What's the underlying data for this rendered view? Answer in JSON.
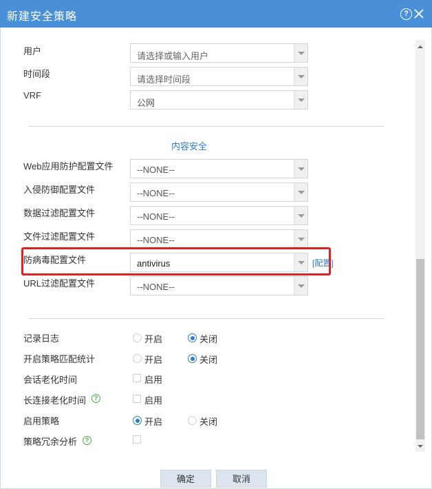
{
  "dialog": {
    "title": "新建安全策略",
    "help_symbol": "?"
  },
  "fields": {
    "user": {
      "label": "用户",
      "placeholder": "请选择或输入用户"
    },
    "time_range": {
      "label": "时间段",
      "placeholder": "请选择时间段"
    },
    "vrf": {
      "label": "VRF",
      "value": "公网"
    }
  },
  "content_security": {
    "title": "内容安全",
    "waf": {
      "label": "Web应用防护配置文件",
      "value": "--NONE--"
    },
    "ips": {
      "label": "入侵防御配置文件",
      "value": "--NONE--"
    },
    "data_filter": {
      "label": "数据过滤配置文件",
      "value": "--NONE--"
    },
    "file_filter": {
      "label": "文件过滤配置文件",
      "value": "--NONE--"
    },
    "antivirus": {
      "label": "防病毒配置文件",
      "value": "antivirus",
      "config_link": "[配置]"
    },
    "url_filter": {
      "label": "URL过滤配置文件",
      "value": "--NONE--"
    }
  },
  "options": {
    "log": {
      "label": "记录日志",
      "on": "开启",
      "off": "关闭",
      "selected": "off"
    },
    "match_stats": {
      "label": "开启策略匹配统计",
      "on": "开启",
      "off": "关闭",
      "selected": "off"
    },
    "session_aging": {
      "label": "会话老化时间",
      "enable": "启用",
      "checked": false
    },
    "long_conn_aging": {
      "label": "长连接老化时间",
      "enable": "启用",
      "checked": false,
      "help_symbol": "?"
    },
    "enable_policy": {
      "label": "启用策略",
      "on": "开启",
      "off": "关闭",
      "selected": "on"
    },
    "redundancy": {
      "label": "策略冗余分析",
      "checked": false,
      "help_symbol": "?"
    }
  },
  "buttons": {
    "confirm": "确定",
    "cancel": "取消"
  },
  "colors": {
    "titlebar": "#4a90d9",
    "link": "#2b7ccf",
    "highlight": "#e02020",
    "help_green": "#44b244"
  }
}
